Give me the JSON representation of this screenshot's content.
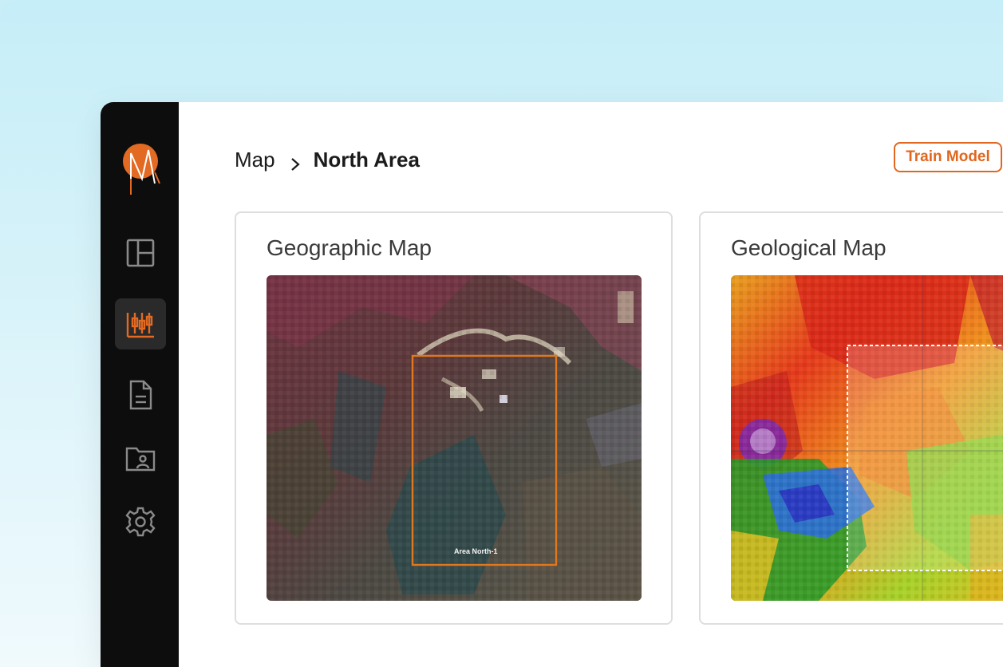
{
  "breadcrumb": {
    "root": "Map",
    "separator_icon": "chevron-right-icon",
    "current": "North Area"
  },
  "toolbar": {
    "train_label": "Train Model",
    "accent_color": "#e0671f"
  },
  "sidebar": {
    "logo": "company-logo",
    "items": [
      {
        "icon": "dashboard-layout-icon",
        "active": false
      },
      {
        "icon": "analytics-sliders-icon",
        "active": true
      },
      {
        "icon": "document-icon",
        "active": false
      },
      {
        "icon": "user-folder-icon",
        "active": false
      },
      {
        "icon": "settings-gear-icon",
        "active": false
      }
    ]
  },
  "cards": {
    "geographic": {
      "title": "Geographic Map",
      "region_label": "Area North-1"
    },
    "geological": {
      "title": "Geological Map"
    }
  }
}
